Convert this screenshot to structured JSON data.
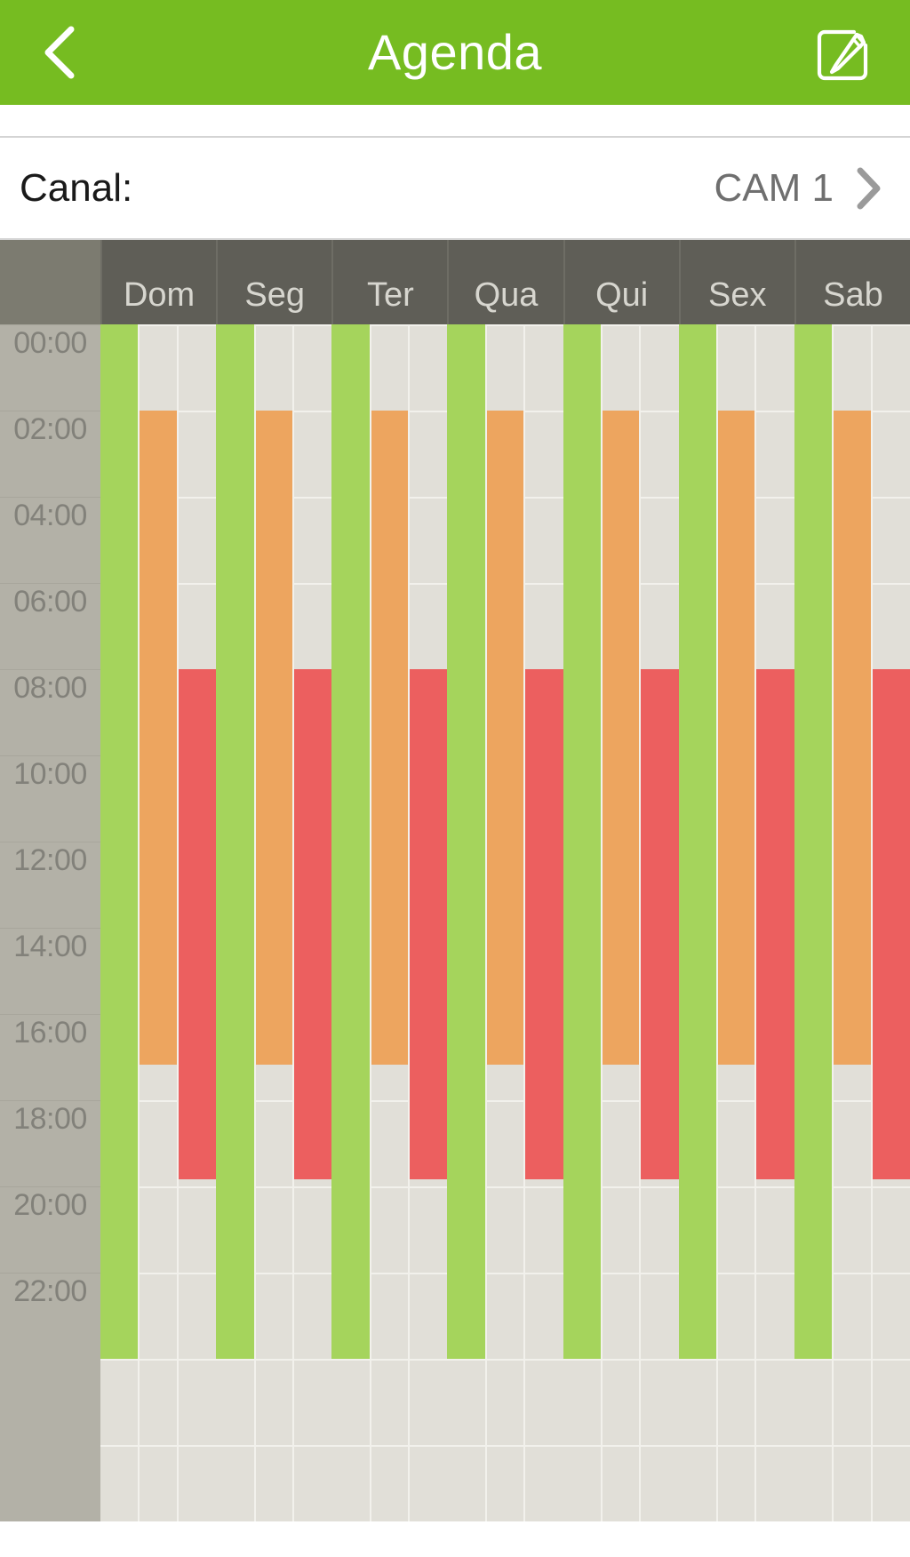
{
  "appbar": {
    "title": "Agenda",
    "back_icon": "chevron-left-icon",
    "edit_icon": "edit-pencil-square-icon",
    "background_color": "#76bc21"
  },
  "channel": {
    "label": "Canal:",
    "value": "CAM 1",
    "chevron_icon": "chevron-right-icon"
  },
  "schedule": {
    "day_headers": [
      "Dom",
      "Seg",
      "Ter",
      "Qua",
      "Qui",
      "Sex",
      "Sab"
    ],
    "time_labels": [
      "00:00",
      "02:00",
      "04:00",
      "06:00",
      "08:00",
      "10:00",
      "12:00",
      "14:00",
      "16:00",
      "18:00",
      "20:00",
      "22:00"
    ],
    "legend_colors": {
      "green": "#a5d45c",
      "orange": "#eda55f",
      "red": "#ec5f5f",
      "inactive": "#e1dfd8",
      "gutter": "#b3b1a7",
      "header": "#5f5e57",
      "header_corner": "#7c7b70"
    },
    "tracks_per_day": 3,
    "track_names": [
      "track-1-green",
      "track-2-orange",
      "track-3-red"
    ],
    "day_schedule": [
      {
        "day": "Dom",
        "tracks": [
          {
            "name": "track-1-green",
            "color": "green",
            "start": "00:00",
            "end": "24:00"
          },
          {
            "name": "track-2-orange",
            "color": "orange",
            "start": "02:00",
            "end": "17:10"
          },
          {
            "name": "track-3-red",
            "color": "red",
            "start": "08:00",
            "end": "19:50"
          }
        ]
      },
      {
        "day": "Seg",
        "tracks": [
          {
            "name": "track-1-green",
            "color": "green",
            "start": "00:00",
            "end": "24:00"
          },
          {
            "name": "track-2-orange",
            "color": "orange",
            "start": "02:00",
            "end": "17:10"
          },
          {
            "name": "track-3-red",
            "color": "red",
            "start": "08:00",
            "end": "19:50"
          }
        ]
      },
      {
        "day": "Ter",
        "tracks": [
          {
            "name": "track-1-green",
            "color": "green",
            "start": "00:00",
            "end": "24:00"
          },
          {
            "name": "track-2-orange",
            "color": "orange",
            "start": "02:00",
            "end": "17:10"
          },
          {
            "name": "track-3-red",
            "color": "red",
            "start": "08:00",
            "end": "19:50"
          }
        ]
      },
      {
        "day": "Qua",
        "tracks": [
          {
            "name": "track-1-green",
            "color": "green",
            "start": "00:00",
            "end": "24:00"
          },
          {
            "name": "track-2-orange",
            "color": "orange",
            "start": "02:00",
            "end": "17:10"
          },
          {
            "name": "track-3-red",
            "color": "red",
            "start": "08:00",
            "end": "19:50"
          }
        ]
      },
      {
        "day": "Qui",
        "tracks": [
          {
            "name": "track-1-green",
            "color": "green",
            "start": "00:00",
            "end": "24:00"
          },
          {
            "name": "track-2-orange",
            "color": "orange",
            "start": "02:00",
            "end": "17:10"
          },
          {
            "name": "track-3-red",
            "color": "red",
            "start": "08:00",
            "end": "19:50"
          }
        ]
      },
      {
        "day": "Sex",
        "tracks": [
          {
            "name": "track-1-green",
            "color": "green",
            "start": "00:00",
            "end": "24:00"
          },
          {
            "name": "track-2-orange",
            "color": "orange",
            "start": "02:00",
            "end": "17:10"
          },
          {
            "name": "track-3-red",
            "color": "red",
            "start": "08:00",
            "end": "19:50"
          }
        ]
      },
      {
        "day": "Sab",
        "tracks": [
          {
            "name": "track-1-green",
            "color": "green",
            "start": "00:00",
            "end": "24:00"
          },
          {
            "name": "track-2-orange",
            "color": "orange",
            "start": "02:00",
            "end": "17:10"
          },
          {
            "name": "track-3-red",
            "color": "red",
            "start": "08:00",
            "end": "19:50"
          }
        ]
      }
    ]
  }
}
